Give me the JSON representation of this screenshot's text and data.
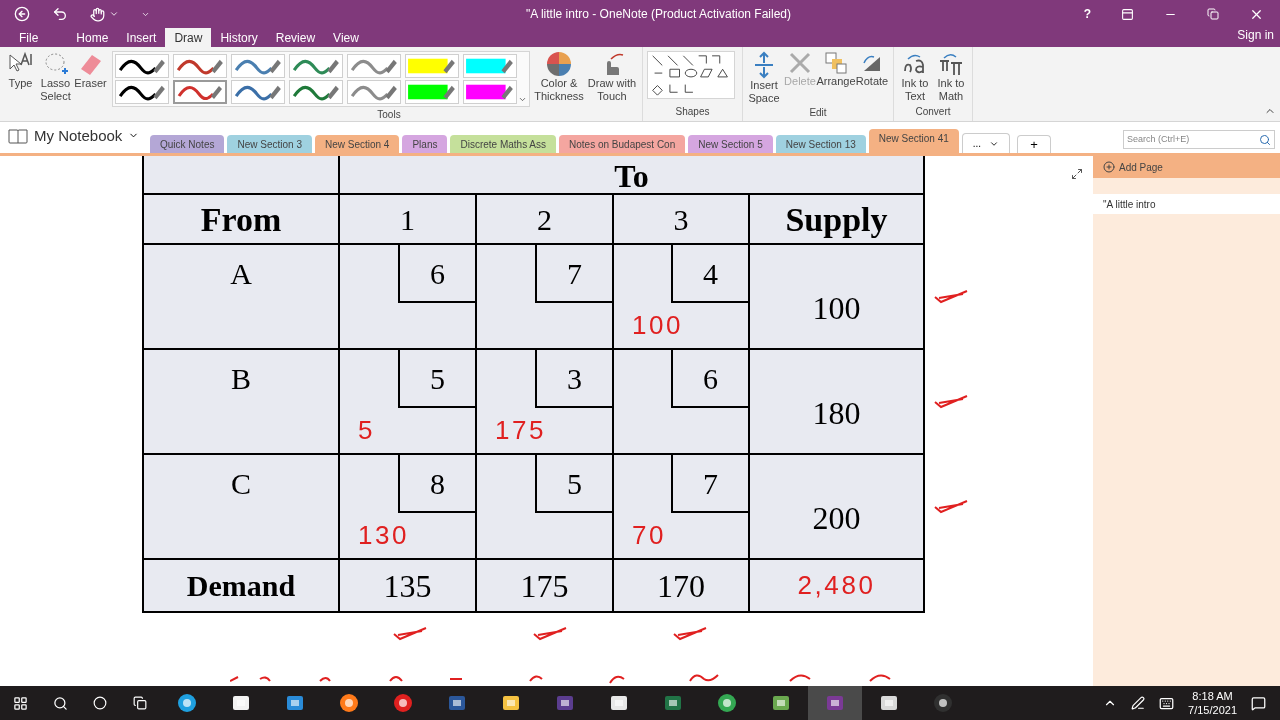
{
  "window": {
    "title": "\"A little intro - OneNote (Product Activation Failed)",
    "help": "?"
  },
  "menu_tabs": [
    {
      "label": "File",
      "selected": false
    },
    {
      "label": "Home",
      "selected": false
    },
    {
      "label": "Insert",
      "selected": false
    },
    {
      "label": "Draw",
      "selected": true
    },
    {
      "label": "History",
      "selected": false
    },
    {
      "label": "Review",
      "selected": false
    },
    {
      "label": "View",
      "selected": false
    }
  ],
  "account": "Sign in",
  "ribbon": {
    "tools": [
      {
        "kind": "type",
        "label": "Type"
      },
      {
        "kind": "lasso",
        "label": "Lasso Select"
      },
      {
        "kind": "eraser",
        "label": "Eraser"
      }
    ],
    "pens": [
      {
        "kind": "pen",
        "color": "#000000",
        "selected": false
      },
      {
        "kind": "pen",
        "color": "#c0392b",
        "selected": false
      },
      {
        "kind": "pen",
        "color": "#4a7fb0",
        "selected": false
      },
      {
        "kind": "pen",
        "color": "#2e8b57",
        "selected": false
      },
      {
        "kind": "pen",
        "color": "#8c8c8c",
        "selected": false
      },
      {
        "kind": "highlighter",
        "color": "#ffff00",
        "selected": false
      },
      {
        "kind": "highlighter",
        "color": "#00ffff",
        "selected": false
      },
      {
        "kind": "pen",
        "color": "#000000",
        "selected": false
      },
      {
        "kind": "pen",
        "color": "#d0312d",
        "selected": true
      },
      {
        "kind": "pen",
        "color": "#3b6fa8",
        "selected": false
      },
      {
        "kind": "pen",
        "color": "#1f7a3a",
        "selected": false
      },
      {
        "kind": "pen",
        "color": "#8c8c8c",
        "selected": false
      },
      {
        "kind": "highlighter",
        "color": "#00ff00",
        "selected": false
      },
      {
        "kind": "highlighter",
        "color": "#ff00ff",
        "selected": false
      }
    ],
    "tools_group": "Tools",
    "color_thickness": "Color & Thickness",
    "draw_touch": "Draw with Touch",
    "shapes_group": "Shapes",
    "edit": [
      {
        "kind": "insert",
        "label": "Insert Space",
        "disabled": false
      },
      {
        "kind": "delete",
        "label": "Delete",
        "disabled": true
      },
      {
        "kind": "arrange",
        "label": "Arrange",
        "disabled": false
      },
      {
        "kind": "rotate",
        "label": "Rotate",
        "disabled": false
      }
    ],
    "edit_group": "Edit",
    "convert": [
      {
        "kind": "text",
        "label": "Ink to Text"
      },
      {
        "kind": "math",
        "label": "Ink to Math"
      }
    ],
    "convert_group": "Convert"
  },
  "notebook": "My Notebook",
  "sections": [
    {
      "label": "Quick Notes",
      "color": "#b4a7d6",
      "selected": false
    },
    {
      "label": "New Section 3",
      "color": "#9fd1e0",
      "selected": false
    },
    {
      "label": "New Section 4",
      "color": "#f4b183",
      "selected": false
    },
    {
      "label": "Plans",
      "color": "#d5a6e0",
      "selected": false
    },
    {
      "label": "Discrete Maths Ass",
      "color": "#c5e09b",
      "selected": false
    },
    {
      "label": "Notes on Budapest Con",
      "color": "#f4a6a0",
      "selected": false
    },
    {
      "label": "New Section 5",
      "color": "#d5a6e0",
      "selected": false
    },
    {
      "label": "New Section 13",
      "color": "#9fd1e0",
      "selected": false
    },
    {
      "label": "New Section 41",
      "color": "#f4b183",
      "selected": true
    }
  ],
  "more_sections": "...",
  "add_section": "+",
  "search": {
    "placeholder": "Search (Ctrl+E)"
  },
  "pages": {
    "add": "Add Page",
    "items": [
      {
        "title": "\"A little intro"
      }
    ]
  },
  "table": {
    "top": "To",
    "header_row": [
      "From",
      "1",
      "2",
      "3",
      "Supply"
    ],
    "body": [
      {
        "label": "A",
        "cells": [
          {
            "cost": "6"
          },
          {
            "cost": "7"
          },
          {
            "cost": "4",
            "allocation": "100"
          }
        ],
        "supply": "100",
        "checked": true
      },
      {
        "label": "B",
        "cells": [
          {
            "cost": "5",
            "allocation": "5"
          },
          {
            "cost": "3",
            "allocation": "175"
          },
          {
            "cost": "6"
          }
        ],
        "supply": "180",
        "checked": true
      },
      {
        "label": "C",
        "cells": [
          {
            "cost": "8",
            "allocation": "130"
          },
          {
            "cost": "5"
          },
          {
            "cost": "7",
            "allocation": "70"
          }
        ],
        "supply": "200",
        "checked": true
      }
    ],
    "demand": {
      "label": "Demand",
      "values": [
        {
          "value": "135",
          "checked": true
        },
        {
          "value": "175",
          "checked": true
        },
        {
          "value": "170",
          "checked": true
        }
      ],
      "total": "2,480"
    }
  },
  "taskbar": {
    "apps": [
      {
        "kind": "edge",
        "selected": false
      },
      {
        "kind": "store",
        "selected": false
      },
      {
        "kind": "mail",
        "selected": false
      },
      {
        "kind": "firefox",
        "selected": false
      },
      {
        "kind": "opera",
        "selected": false
      },
      {
        "kind": "word",
        "selected": false
      },
      {
        "kind": "files",
        "selected": false
      },
      {
        "kind": "tex",
        "selected": false
      },
      {
        "kind": "doc",
        "selected": false
      },
      {
        "kind": "excel",
        "selected": false
      },
      {
        "kind": "chrome",
        "selected": false
      },
      {
        "kind": "image",
        "selected": false
      },
      {
        "kind": "onenote",
        "selected": true
      },
      {
        "kind": "satellite",
        "selected": false
      },
      {
        "kind": "obs",
        "selected": false
      }
    ],
    "time": "8:18 AM",
    "date": "7/15/2021"
  }
}
